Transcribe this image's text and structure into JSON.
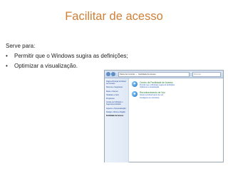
{
  "slide": {
    "title": "Facilitar de acesso",
    "intro": "Serve para:",
    "bullets": [
      "Permitir que o Windows sugira as definições;",
      "Optimizar a visualização."
    ],
    "colors": {
      "title": "#cf7f36",
      "text": "#222222"
    }
  },
  "screenshot": {
    "breadcrumb": [
      "Painel de Controlo",
      "Facilidade de Acesso"
    ],
    "search_placeholder": "Procurar",
    "sidebar": [
      "Página Principal do Painel de Controlo",
      "Sistema e Segurança",
      "Rede e Internet",
      "Hardware e Som",
      "Programas",
      "Contas de Utilizador e Segurança Familiar",
      "Aspecto e Personalização",
      "Relógio, Idioma e Região",
      "Facilidade de Acesso"
    ],
    "active_sidebar_index": 8,
    "sections": [
      {
        "icon": "ease-of-access-icon",
        "title": "Centro de Facilidade de Acesso",
        "links": [
          "Permitir que o Windows sugira as definições",
          "Optimizar a visualização"
        ]
      },
      {
        "icon": "speech-recognition-icon",
        "title": "Reconhecimento de Voz",
        "links": [
          "Iniciar reconhecimento de voz",
          "Configurar um microfone"
        ]
      }
    ]
  }
}
